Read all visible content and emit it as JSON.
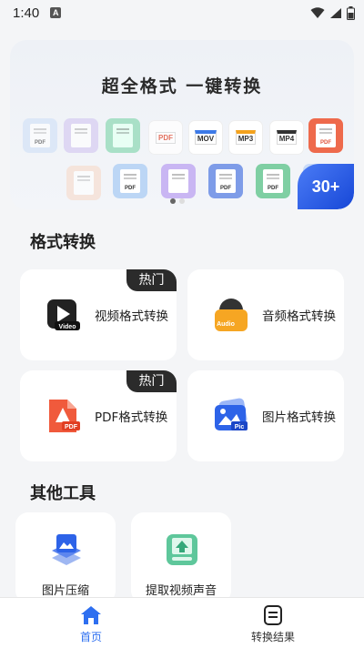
{
  "status_bar": {
    "time": "1:40",
    "notif_letter": "A"
  },
  "banner": {
    "title": "超全格式 一键转换",
    "badge": "30+",
    "tiles": [
      "PDF",
      "MOV",
      "MP3",
      "MP4",
      "PDF",
      "PDF",
      "PDF",
      "PDF"
    ]
  },
  "format_section": {
    "title": "格式转换",
    "cards": [
      {
        "label": "视频格式转换",
        "icon": "video-file-icon",
        "icon_text": "Video",
        "hot": "热门"
      },
      {
        "label": "音频格式转换",
        "icon": "audio-file-icon",
        "icon_text": "Audio"
      },
      {
        "label": "PDF格式转换",
        "icon": "pdf-file-icon",
        "icon_text": "PDF",
        "hot": "热门"
      },
      {
        "label": "图片格式转换",
        "icon": "picture-file-icon",
        "icon_text": "Pic"
      }
    ]
  },
  "tools_section": {
    "title": "其他工具",
    "tools": [
      {
        "label": "图片压缩",
        "icon": "image-compress-icon"
      },
      {
        "label": "提取视频声音",
        "icon": "extract-audio-icon"
      }
    ]
  },
  "bottom_nav": {
    "items": [
      {
        "label": "首页",
        "icon": "home-icon",
        "active": true
      },
      {
        "label": "转换结果",
        "icon": "results-icon",
        "active": false
      }
    ]
  },
  "colors": {
    "accent": "#2e6ff0",
    "hot_badge": "#2b2b2b"
  }
}
